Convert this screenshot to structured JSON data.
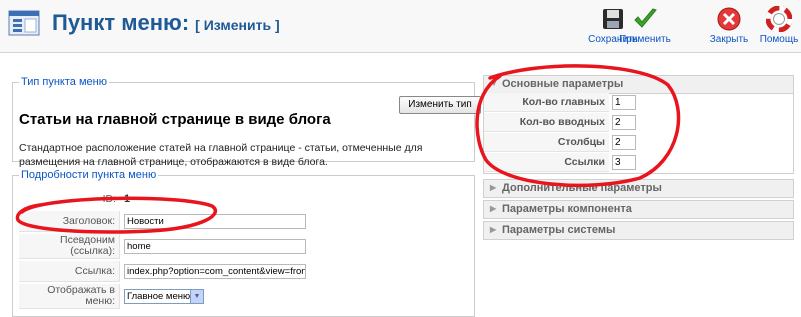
{
  "header": {
    "title": "Пункт меню:",
    "subtitle": "[ Изменить ]",
    "buttons": [
      {
        "label": "Сохранить",
        "icon": "save-icon"
      },
      {
        "label": "Применить",
        "icon": "apply-check-icon"
      },
      {
        "label": "Закрыть",
        "icon": "close-icon"
      },
      {
        "label": "Помощь",
        "icon": "help-lifebuoy-icon"
      }
    ]
  },
  "menu_item_type": {
    "legend": "Тип пункта меню",
    "heading": "Статьи на главной странице в виде блога",
    "change_button": "Изменить тип",
    "description": "Стандартное расположение статей на главной странице - статьи, отмеченные для размещения на главной странице, отображаются в виде блога."
  },
  "details": {
    "legend": "Подробности пункта меню",
    "id_label": "ID:",
    "id_value": "1",
    "title_label": "Заголовок:",
    "title_value": "Новости",
    "alias_label": "Псевдоним (ссылка):",
    "alias_value": "home",
    "link_label": "Ссылка:",
    "link_value": "index.php?option=com_content&view=frontpa",
    "display_label": "Отображать в меню:",
    "display_value": "Главное меню"
  },
  "basic_params": {
    "title": "Основные параметры",
    "rows": [
      {
        "label": "Кол-во главных",
        "value": "1"
      },
      {
        "label": "Кол-во вводных",
        "value": "2"
      },
      {
        "label": "Столбцы",
        "value": "2"
      },
      {
        "label": "Ссылки",
        "value": "3"
      }
    ]
  },
  "collapsed_panels": [
    "Дополнительные параметры",
    "Параметры компонента",
    "Параметры системы"
  ],
  "colors": {
    "accent_blue": "#1e5a96",
    "link_blue": "#0b55c4",
    "annotation_red": "#e8141e"
  }
}
